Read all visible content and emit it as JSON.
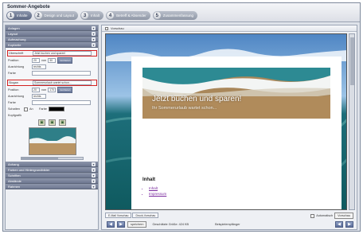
{
  "app": {
    "title": "Sommer-Angebote"
  },
  "steps": [
    {
      "num": "1",
      "label": "Inhalte",
      "active": true
    },
    {
      "num": "2",
      "label": "Design und Layout",
      "active": false
    },
    {
      "num": "3",
      "label": "Inhalt",
      "active": false
    },
    {
      "num": "4",
      "label": "Betreff & Absender",
      "active": false
    },
    {
      "num": "5",
      "label": "Zusammenfassung",
      "active": false
    }
  ],
  "sidebar": {
    "sections_top": [
      "Anlagen",
      "Layout",
      "Aufmachung",
      "Kopfzeile"
    ],
    "kopfzeile": {
      "ueberschrift_label": "Überschrift",
      "ueberschrift_value": "Jetzt buchen und sparen!",
      "position_label": "Position",
      "pos1": "20",
      "pos1_unit": "von",
      "pos2": "30",
      "zentrieren": "zentrieren",
      "ausrichtung_label": "Ausrichtung",
      "ausrichtung_value": "rechts",
      "farbe_label": "Farbe",
      "slogan_label": "Slogan",
      "slogan_value": "Sommerurlaub wartet schon...",
      "pos3": "20",
      "pos3_unit": "von",
      "pos4": "170",
      "ausrichtung2_value": "rechts",
      "schatten_label": "Schatten",
      "schatten_option": "An",
      "farbe2_label": "Farbe",
      "kopfgrafik_label": "Kopfgrafik"
    },
    "sections_bottom": [
      "Anhang",
      "Farben und Hintergrundbilder",
      "Schriften",
      "Abstände",
      "Rahmen"
    ]
  },
  "preview": {
    "title": "Vorschau",
    "banner_title": "Jetzt buchen und sparen!",
    "banner_subtitle": "Ihr Sommerurlaub wartet schon...",
    "inhalt_title": "Inhalt",
    "links": [
      "Inhalt",
      "Impressum"
    ],
    "tabs": [
      "E-Mail Vorschau",
      "Druck-Vorschau"
    ],
    "auto_label": "Automatisch",
    "auto_button": "Vorschau"
  },
  "footer": {
    "prev_icon": "arrow-left-icon",
    "next_icon": "arrow-right-icon",
    "speichern": "speichern",
    "size_text": "Geschätzte Größe: 424 KB",
    "empfaenger": "Beispielempfänger"
  },
  "colors": {
    "accent": "#6e7891",
    "highlight": "#d32020",
    "link": "#7a2a9e"
  }
}
